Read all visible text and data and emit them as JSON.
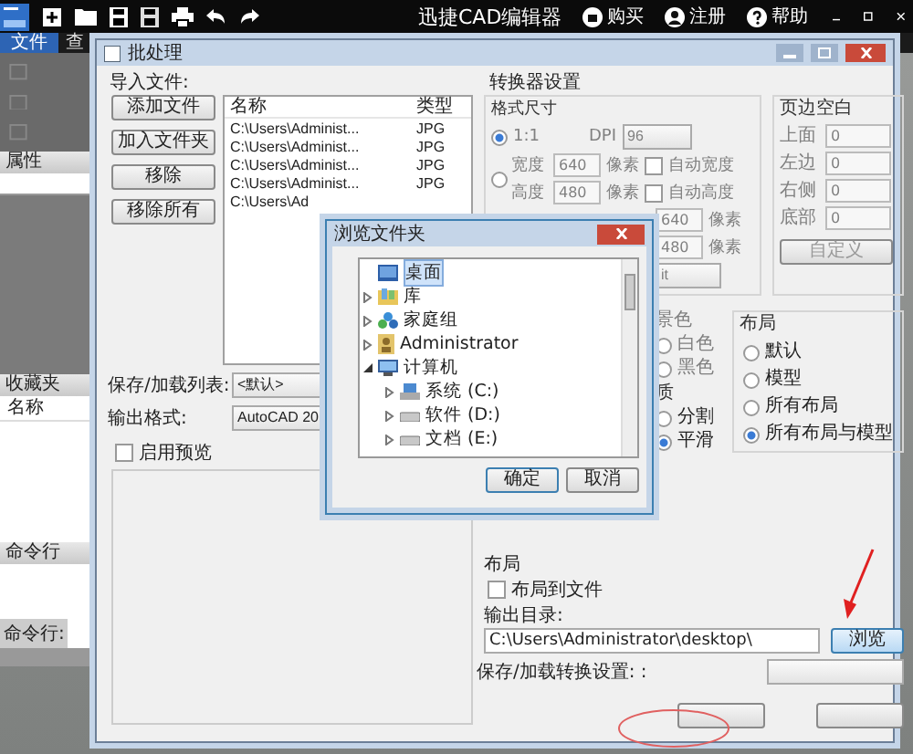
{
  "app": {
    "title": "迅捷CAD编辑器",
    "account_links": [
      {
        "kind": "buy",
        "label": "购买"
      },
      {
        "kind": "register",
        "label": "注册"
      },
      {
        "kind": "help",
        "label": "帮助"
      }
    ],
    "tabs": [
      {
        "label": "文件",
        "selected": true
      },
      {
        "label": "查",
        "selected": false
      }
    ]
  },
  "left_panel": {
    "properties_header": "属性",
    "favorites_header": "收藏夹",
    "favorites_column": "名称",
    "command_header": "命令行",
    "command_prompt": "命令行:"
  },
  "batch_dialog": {
    "title": "批处理",
    "import_label": "导入文件:",
    "import_buttons": [
      "添加文件",
      "加入文件夹",
      "移除",
      "移除所有"
    ],
    "file_list": {
      "columns": [
        "名称",
        "类型"
      ],
      "rows": [
        {
          "name": "C:\\Users\\Administ...",
          "type": "JPG"
        },
        {
          "name": "C:\\Users\\Administ...",
          "type": "JPG"
        },
        {
          "name": "C:\\Users\\Administ...",
          "type": "JPG"
        },
        {
          "name": "C:\\Users\\Administ...",
          "type": "JPG"
        },
        {
          "name": "C:\\Users\\Ad"
        }
      ]
    },
    "save_list": {
      "label": "保存/加载列表:",
      "value": "<默认>"
    },
    "output_format": {
      "label": "输出格式:",
      "value": "AutoCAD 20"
    },
    "preview": {
      "label": "启用预览",
      "checked": false
    },
    "converter": {
      "title": "转换器设置",
      "format_size": {
        "title": "格式尺寸",
        "disabled": true,
        "scale": {
          "label": "1:1",
          "selected": true
        },
        "dpi": {
          "label": "DPI",
          "value": "96"
        },
        "custom": {
          "selected": false
        },
        "width": {
          "label": "宽度",
          "value": "640",
          "unit": "像素",
          "auto_label": "自动宽度",
          "auto_checked": false
        },
        "height": {
          "label": "高度",
          "value": "480",
          "unit": "像素",
          "auto_label": "自动高度",
          "auto_checked": false
        },
        "extra_width": {
          "value": "640",
          "unit": "像素"
        },
        "extra_height": {
          "value": "480",
          "unit": "像素"
        },
        "depth": {
          "value": "it"
        }
      },
      "margins": {
        "title": "页边空白",
        "disabled": true,
        "fields": [
          {
            "label": "上面",
            "value": "0"
          },
          {
            "label": "左边",
            "value": "0"
          },
          {
            "label": "右侧",
            "value": "0"
          },
          {
            "label": "底部",
            "value": "0"
          }
        ],
        "custom_button": "自定义"
      },
      "background": {
        "title": "景色",
        "disabled": true,
        "options": [
          {
            "label": "白色",
            "selected": false
          },
          {
            "label": "黑色",
            "selected": false
          }
        ]
      },
      "quality": {
        "title": "质",
        "options": [
          {
            "label": "分割",
            "selected": false
          },
          {
            "label": "平滑",
            "selected": true
          }
        ]
      },
      "layout": {
        "title": "布局",
        "options": [
          {
            "label": "默认",
            "selected": false
          },
          {
            "label": "模型",
            "selected": false
          },
          {
            "label": "所有布局",
            "selected": false
          },
          {
            "label": "所有布局与模型",
            "selected": true
          }
        ]
      }
    },
    "layout_export": {
      "title": "布局",
      "label": "布局到文件",
      "checked": false
    },
    "output_dir": {
      "label": "输出目录:",
      "value": "C:\\Users\\Administrator\\desktop\\",
      "browse_button": "浏览"
    },
    "save_settings": {
      "label": "保存/加载转换设置: :"
    }
  },
  "browse_dialog": {
    "title": "浏览文件夹",
    "tree": [
      {
        "label": "桌面",
        "kind": "desktop",
        "selected": true
      },
      {
        "label": "库",
        "kind": "library",
        "selected": false,
        "expanded": false
      },
      {
        "label": "家庭组",
        "kind": "homegroup",
        "selected": false,
        "expanded": false
      },
      {
        "label": "Administrator",
        "kind": "user",
        "selected": false,
        "expanded": false
      },
      {
        "label": "计算机",
        "kind": "computer",
        "selected": false,
        "expanded": true,
        "children": [
          {
            "label": "系统 (C:)",
            "kind": "system-drive",
            "selected": false,
            "expanded": false
          },
          {
            "label": "软件 (D:)",
            "kind": "drive",
            "selected": false,
            "expanded": false
          },
          {
            "label": "文档 (E:)",
            "kind": "drive",
            "selected": false,
            "expanded": false
          }
        ]
      }
    ],
    "buttons": [
      "确定",
      "取消"
    ]
  }
}
